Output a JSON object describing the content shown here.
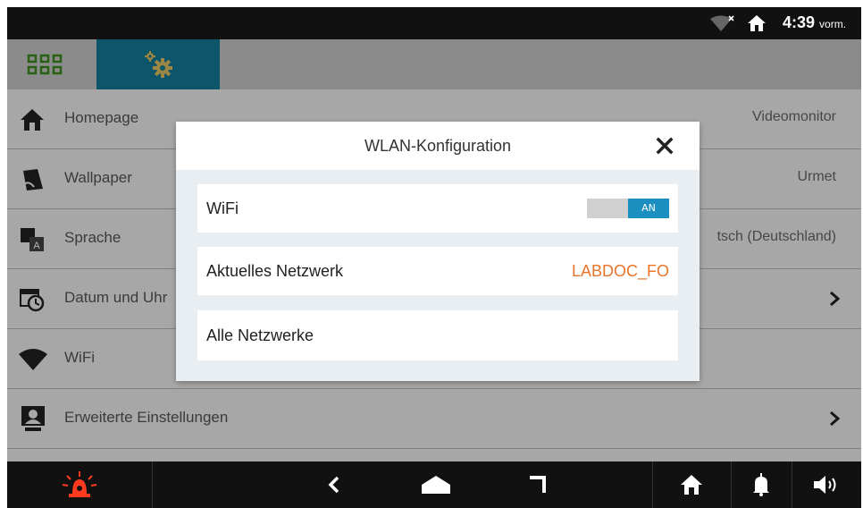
{
  "status_bar": {
    "time": "4:39",
    "ampm": "vorm."
  },
  "settings": {
    "rows": [
      {
        "label": "Homepage",
        "value": "Videomonitor"
      },
      {
        "label": "Wallpaper",
        "value": "Urmet"
      },
      {
        "label": "Sprache",
        "value": "tsch (Deutschland)"
      },
      {
        "label": "Datum und Uhr",
        "value": ""
      },
      {
        "label": "WiFi",
        "value": ""
      },
      {
        "label": "Erweiterte Einstellungen",
        "value": ""
      }
    ]
  },
  "dialog": {
    "title": "WLAN-Konfiguration",
    "wifi_label": "WiFi",
    "wifi_toggle": "AN",
    "current_network_label": "Aktuelles Netzwerk",
    "current_network_value": "LABDOC_FO",
    "all_networks_label": "Alle Netzwerke"
  },
  "colors": {
    "accent": "#147a96",
    "toggle_on": "#1a8fc0",
    "network_value": "#e8752a",
    "alarm": "#ff3b1f"
  }
}
